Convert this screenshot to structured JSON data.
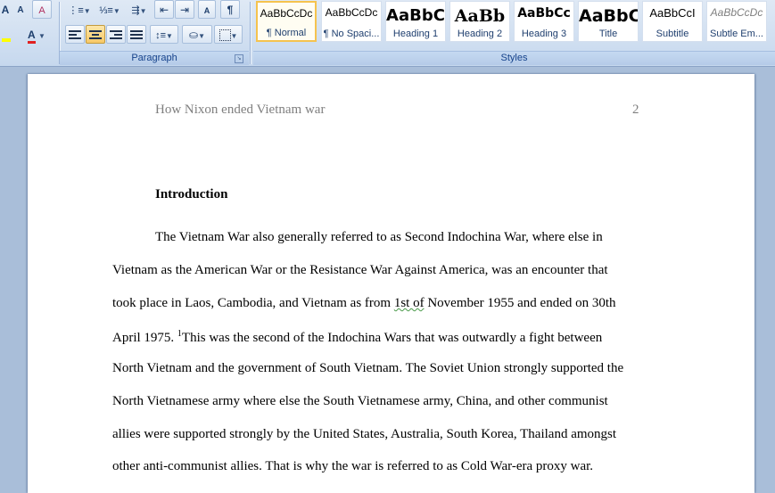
{
  "ribbon": {
    "paragraph_group_label": "Paragraph",
    "styles_group_label": "Styles",
    "font_buttons": {
      "grow": "A",
      "shrink": "A",
      "font_color": "A"
    },
    "show_marks": "¶",
    "sort": "↓",
    "style_gallery": [
      {
        "sample": "AaBbCcDc",
        "name": "¶ Normal",
        "selected": true
      },
      {
        "sample": "AaBbCcDc",
        "name": "¶ No Spaci..."
      },
      {
        "sample": "AaBbC",
        "name": "Heading 1"
      },
      {
        "sample": "AaBb",
        "name": "Heading 2"
      },
      {
        "sample": "AaBbCc",
        "name": "Heading 3"
      },
      {
        "sample": "AaBbC",
        "name": "Title"
      },
      {
        "sample": "AaBbCcI",
        "name": "Subtitle"
      },
      {
        "sample": "AaBbCcDc",
        "name": "Subtle Em..."
      }
    ],
    "colors": {
      "highlight": "#ffff00",
      "font_color": "#e02020"
    }
  },
  "document": {
    "header_title": "How Nixon ended Vietnam war",
    "page_number": "2",
    "heading": "Introduction",
    "lines": [
      "The Vietnam War also generally referred to as Second Indochina War, where else in",
      "Vietnam as the American War or the Resistance War Against America, was an encounter that",
      "took place in Laos, Cambodia, and Vietnam as from",
      "April 1975.",
      "North Vietnam and the government of South Vietnam. The Soviet Union strongly supported the",
      "North Vietnamese army where else the South Vietnamese army, China, and other communist",
      "allies were supported strongly by the United States, Australia, South Korea, Thailand amongst",
      "other anti-communist allies.  That is why the war is referred to as Cold War-era proxy war."
    ],
    "line3_flagged": "1st  of",
    "line3_tail": " November 1955 and ended on 30th",
    "footnote_mark": "1",
    "line4_tail": "This was the second of the Indochina Wars that was outwardly a fight between"
  }
}
